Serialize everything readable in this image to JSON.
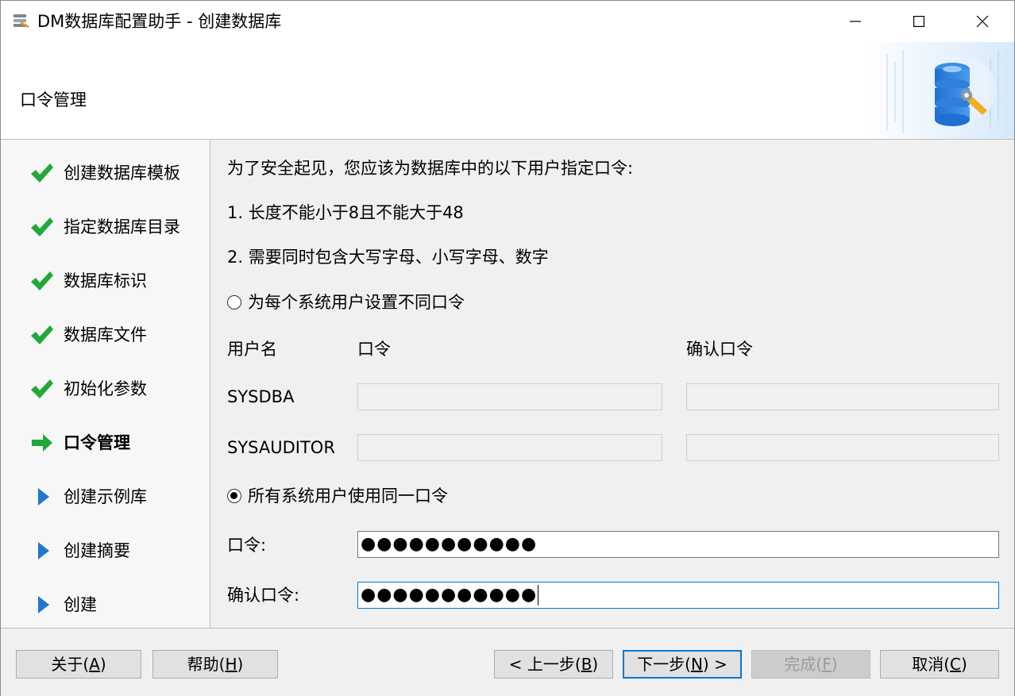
{
  "window": {
    "title": "DM数据库配置助手 - 创建数据库"
  },
  "header": {
    "title": "口令管理"
  },
  "steps": [
    {
      "label": "创建数据库模板",
      "state": "done"
    },
    {
      "label": "指定数据库目录",
      "state": "done"
    },
    {
      "label": "数据库标识",
      "state": "done"
    },
    {
      "label": "数据库文件",
      "state": "done"
    },
    {
      "label": "初始化参数",
      "state": "done"
    },
    {
      "label": "口令管理",
      "state": "current"
    },
    {
      "label": "创建示例库",
      "state": "pending"
    },
    {
      "label": "创建摘要",
      "state": "pending"
    },
    {
      "label": "创建",
      "state": "pending"
    }
  ],
  "content": {
    "intro": "为了安全起见，您应该为数据库中的以下用户指定口令:",
    "rule1": "1. 长度不能小于8且不能大于48",
    "rule2": "2. 需要同时包含大写字母、小写字母、数字",
    "option_separate": "为每个系统用户设置不同口令",
    "option_same": "所有系统用户使用同一口令",
    "selected_option": "same",
    "col_user": "用户名",
    "col_password": "口令",
    "col_confirm": "确认口令",
    "users": [
      "SYSDBA",
      "SYSAUDITOR"
    ],
    "password_label": "口令:",
    "confirm_label": "确认口令:",
    "password_value": "●●●●●●●●●●●",
    "confirm_value": "●●●●●●●●●●●"
  },
  "buttons": {
    "about_text": "关于(",
    "about_key": "A",
    "help_text": "帮助(",
    "help_key": "H",
    "back_text": "< 上一步(",
    "back_key": "B",
    "next_text": "下一步(",
    "next_key": "N",
    "next_suffix": ") >",
    "finish_text": "完成(",
    "finish_key": "F",
    "cancel_text": "取消(",
    "cancel_key": "C",
    "close_paren": ")"
  },
  "colors": {
    "check_green": "#22a83a",
    "arrow_green": "#22a83a",
    "pending_blue": "#1e78d2",
    "focus_blue": "#0078d7"
  }
}
